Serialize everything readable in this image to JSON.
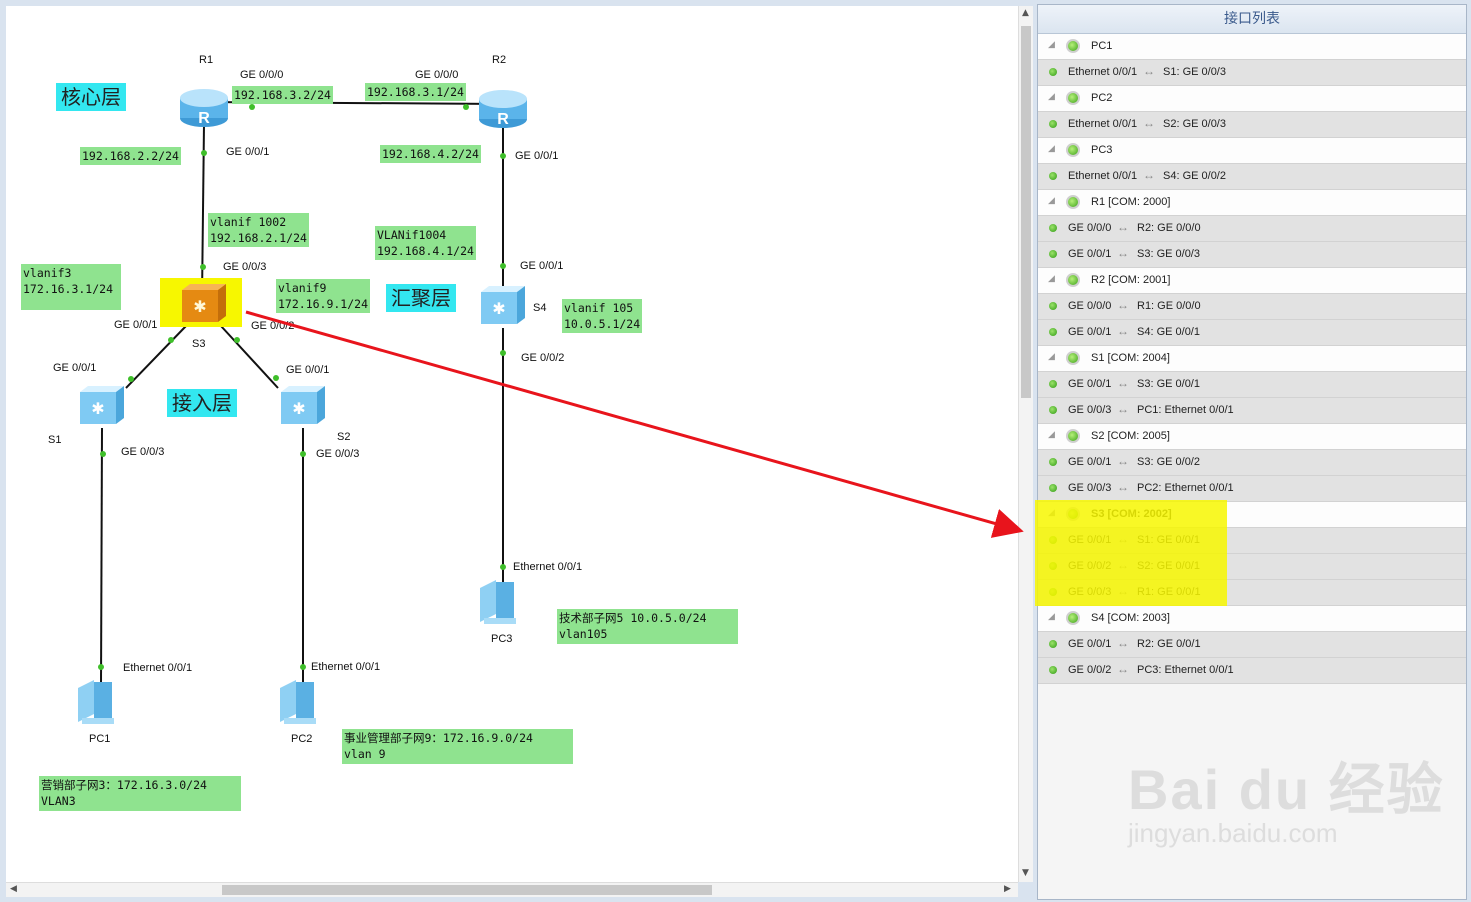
{
  "canvas": {
    "core_layer": "核心层",
    "agg_layer": "汇聚层",
    "access_layer": "接入层",
    "devices": {
      "r1": "R1",
      "r2": "R2",
      "s3": "S3",
      "s4": "S4",
      "s1": "S1",
      "s2": "S2",
      "pc1": "PC1",
      "pc2": "PC2",
      "pc3": "PC3"
    },
    "ports": {
      "r1_ge000": "GE 0/0/0",
      "r2_ge000": "GE 0/0/0",
      "r1_ge001": "GE 0/0/1",
      "r2_ge001": "GE 0/0/1",
      "s3_ge003": "GE 0/0/3",
      "s3_ge001": "GE 0/0/1",
      "s3_ge002": "GE 0/0/2",
      "s4_ge001": "GE 0/0/1",
      "s4_ge002": "GE 0/0/2",
      "s1_ge001": "GE 0/0/1",
      "s2_ge001": "GE 0/0/1",
      "s1_ge003": "GE 0/0/3",
      "s2_ge003": "GE 0/0/3",
      "pc1_eth": "Ethernet 0/0/1",
      "pc2_eth": "Ethernet 0/0/1",
      "pc3_eth": "Ethernet 0/0/1"
    },
    "notes": {
      "r1_ip_top": "192.168.3.2/24",
      "r2_ip_top": "192.168.3.1/24",
      "r1_ip_down": "192.168.2.2/24",
      "r2_ip_down": "192.168.4.2/24",
      "vlanif1002": "vlanif 1002\n192.168.2.1/24",
      "vlanif1004": "VLANif1004\n192.168.4.1/24",
      "vlanif3": "vlanif3\n172.16.3.1/24",
      "vlanif9": "vlanif9\n172.16.9.1/24",
      "vlanif105": "vlanif 105\n10.0.5.1/24",
      "tech": "技术部子网5 10.0.5.0/24\nvlan105",
      "biz": "事业管理部子网9：172.16.9.0/24\nvlan 9",
      "sales": "营销部子网3：172.16.3.0/24\nVLAN3"
    }
  },
  "panel": {
    "title": "接口列表",
    "rows": [
      {
        "kind": "dev",
        "text": "PC1"
      },
      {
        "kind": "port",
        "a": "Ethernet 0/0/1",
        "b": "S1: GE 0/0/3"
      },
      {
        "kind": "dev",
        "text": "PC2"
      },
      {
        "kind": "port",
        "a": "Ethernet 0/0/1",
        "b": "S2: GE 0/0/3"
      },
      {
        "kind": "dev",
        "text": "PC3"
      },
      {
        "kind": "port",
        "a": "Ethernet 0/0/1",
        "b": "S4: GE 0/0/2"
      },
      {
        "kind": "dev",
        "text": "R1 [COM: 2000]"
      },
      {
        "kind": "port",
        "a": "GE 0/0/0",
        "b": "R2: GE 0/0/0"
      },
      {
        "kind": "port",
        "a": "GE 0/0/1",
        "b": "S3: GE 0/0/3"
      },
      {
        "kind": "dev",
        "text": "R2 [COM: 2001]"
      },
      {
        "kind": "port",
        "a": "GE 0/0/0",
        "b": "R1: GE 0/0/0"
      },
      {
        "kind": "port",
        "a": "GE 0/0/1",
        "b": "S4: GE 0/0/1"
      },
      {
        "kind": "dev",
        "text": "S1 [COM: 2004]"
      },
      {
        "kind": "port",
        "a": "GE 0/0/1",
        "b": "S3: GE 0/0/1"
      },
      {
        "kind": "port",
        "a": "GE 0/0/3",
        "b": "PC1: Ethernet 0/0/1"
      },
      {
        "kind": "dev",
        "text": "S2 [COM: 2005]"
      },
      {
        "kind": "port",
        "a": "GE 0/0/1",
        "b": "S3: GE 0/0/2"
      },
      {
        "kind": "port",
        "a": "GE 0/0/3",
        "b": "PC2: Ethernet 0/0/1"
      },
      {
        "kind": "dev",
        "text": "S3 [COM: 2002]",
        "bold": true
      },
      {
        "kind": "port",
        "a": "GE 0/0/1",
        "b": "S1: GE 0/0/1"
      },
      {
        "kind": "port",
        "a": "GE 0/0/2",
        "b": "S2: GE 0/0/1"
      },
      {
        "kind": "port",
        "a": "GE 0/0/3",
        "b": "R1: GE 0/0/1"
      },
      {
        "kind": "dev",
        "text": "S4 [COM: 2003]"
      },
      {
        "kind": "port",
        "a": "GE 0/0/1",
        "b": "R2: GE 0/0/1"
      },
      {
        "kind": "port",
        "a": "GE 0/0/2",
        "b": "PC3: Ethernet 0/0/1"
      }
    ]
  },
  "watermark": {
    "brand": "Bai du 经验",
    "url": "jingyan.baidu.com"
  },
  "colors": {
    "note_bg": "#8fe38f",
    "layer_bg": "#33e7f0",
    "highlight": "#f7f700",
    "arrow": "#e8141c",
    "status_green": "#3da31b"
  }
}
